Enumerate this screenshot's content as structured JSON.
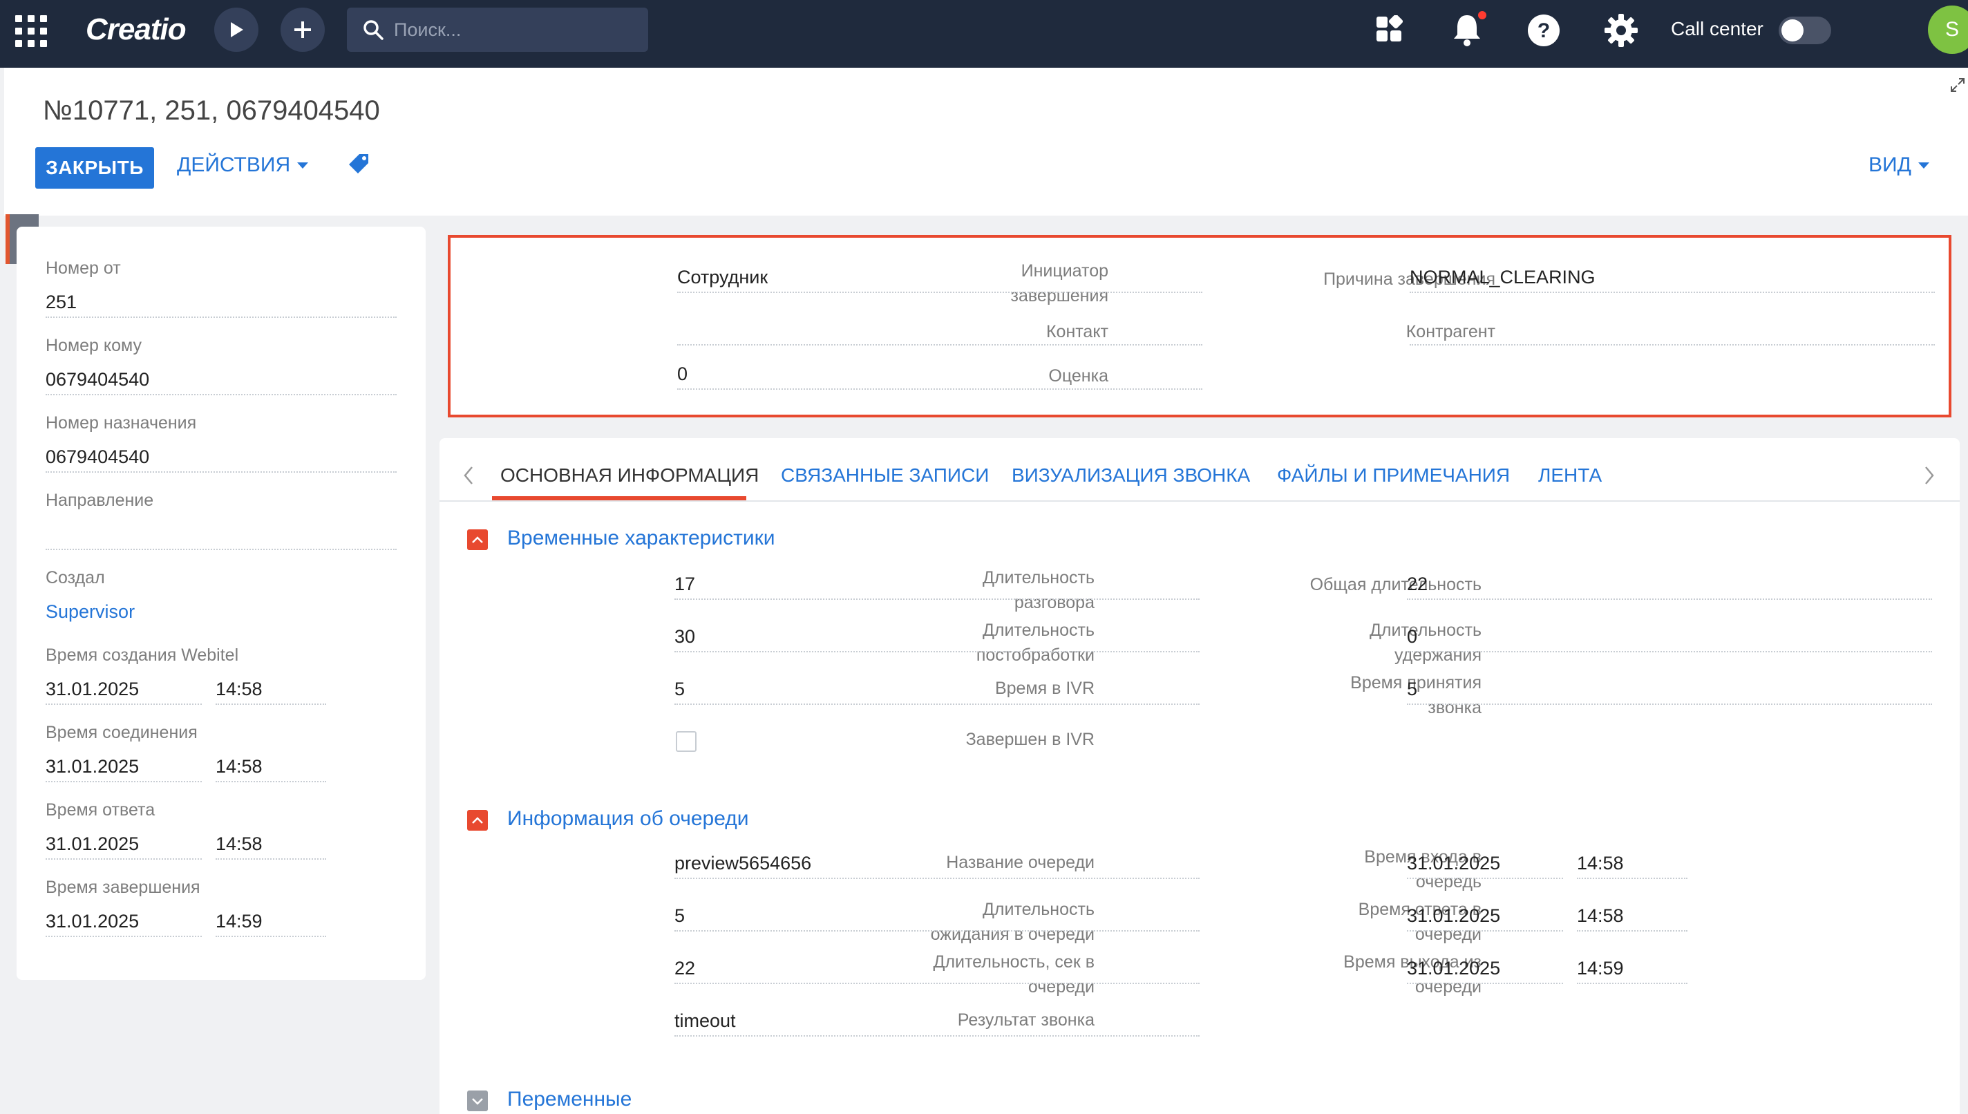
{
  "topbar": {
    "logo": "Creatio",
    "search_placeholder": "Поиск...",
    "call_center_label": "Call center",
    "avatar_letter": "S"
  },
  "header": {
    "title": "№10771, 251, 0679404540",
    "close_label": "ЗАКРЫТЬ",
    "actions_label": "ДЕЙСТВИЯ",
    "view_label": "ВИД"
  },
  "left_panel": {
    "number_from": {
      "label": "Номер от",
      "value": "251"
    },
    "number_to": {
      "label": "Номер кому",
      "value": "0679404540"
    },
    "dest_number": {
      "label": "Номер назначения",
      "value": "0679404540"
    },
    "direction": {
      "label": "Направление",
      "value": ""
    },
    "created_by": {
      "label": "Создал",
      "value": "Supervisor"
    },
    "webitel_created": {
      "label": "Время создания Webitel",
      "date": "31.01.2025",
      "time": "14:58"
    },
    "connect_time": {
      "label": "Время соединения",
      "date": "31.01.2025",
      "time": "14:58"
    },
    "answer_time": {
      "label": "Время ответа",
      "date": "31.01.2025",
      "time": "14:58"
    },
    "end_time": {
      "label": "Время завершения",
      "date": "31.01.2025",
      "time": "14:59"
    }
  },
  "summary": {
    "initiator": {
      "label_l1": "Инициатор",
      "label_l2": "завершения",
      "value": "Сотрудник"
    },
    "end_reason": {
      "label": "Причина завершения",
      "value": "NORMAL_CLEARING"
    },
    "contact": {
      "label": "Контакт",
      "value": ""
    },
    "account": {
      "label": "Контрагент",
      "value": ""
    },
    "rating": {
      "label": "Оценка",
      "value": "0"
    }
  },
  "tabs": [
    "ОСНОВНАЯ ИНФОРМАЦИЯ",
    "СВЯЗАННЫЕ ЗАПИСИ",
    "ВИЗУАЛИЗАЦИЯ ЗВОНКА",
    "ФАЙЛЫ И ПРИМЕЧАНИЯ",
    "ЛЕНТА"
  ],
  "time_section": {
    "title": "Временные характеристики",
    "talk_duration": {
      "label_l1": "Длительность",
      "label_l2": "разговора",
      "value": "17"
    },
    "total_duration": {
      "label": "Общая длительность",
      "value": "22"
    },
    "post_processing": {
      "label_l1": "Длительность",
      "label_l2": "постобработки",
      "value": "30"
    },
    "hold_duration": {
      "label_l1": "Длительность",
      "label_l2": "удержания",
      "value": "0"
    },
    "ivr_time": {
      "label": "Время в IVR",
      "value": "5"
    },
    "accept_time": {
      "label_l1": "Время принятия",
      "label_l2": "звонка",
      "value": "5"
    },
    "ended_in_ivr": {
      "label": "Завершен в IVR"
    }
  },
  "queue_section": {
    "title": "Информация об очереди",
    "queue_name": {
      "label": "Название очереди",
      "value": "preview5654656"
    },
    "queue_enter": {
      "label_l1": "Время входа в",
      "label_l2": "очередь",
      "date": "31.01.2025",
      "time": "14:58"
    },
    "wait_duration": {
      "label_l1": "Длительность",
      "label_l2": "ожидания в очереди",
      "value": "5"
    },
    "queue_answer": {
      "label_l1": "Время ответа в",
      "label_l2": "очереди",
      "date": "31.01.2025",
      "time": "14:58"
    },
    "queue_seconds": {
      "label_l1": "Длительность, сек в",
      "label_l2": "очереди",
      "value": "22"
    },
    "queue_exit": {
      "label_l1": "Время выхода из",
      "label_l2": "очереди",
      "date": "31.01.2025",
      "time": "14:59"
    },
    "call_result": {
      "label": "Результат звонка",
      "value": "timeout"
    }
  },
  "variables_section": {
    "title": "Переменные"
  }
}
